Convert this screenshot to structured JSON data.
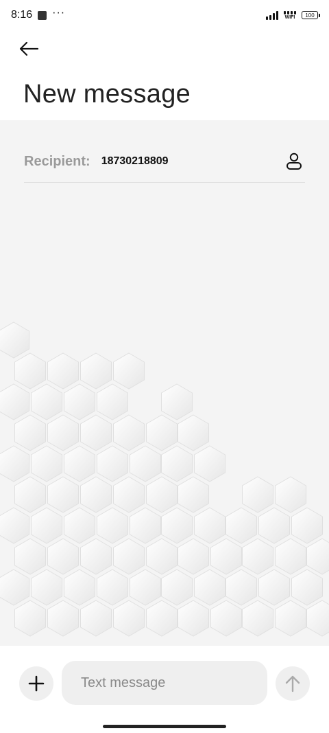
{
  "status": {
    "time": "8:16",
    "battery": "100",
    "wifi_label": "WIFI",
    "more": "···"
  },
  "header": {
    "title": "New message"
  },
  "recipient": {
    "label": "Recipient:",
    "value": "18730218809"
  },
  "composer": {
    "placeholder": "Text message"
  },
  "colors": {
    "accent_gray": "#9a9a9a",
    "field_bg": "#efefef",
    "page_bg": "#f4f4f4"
  }
}
